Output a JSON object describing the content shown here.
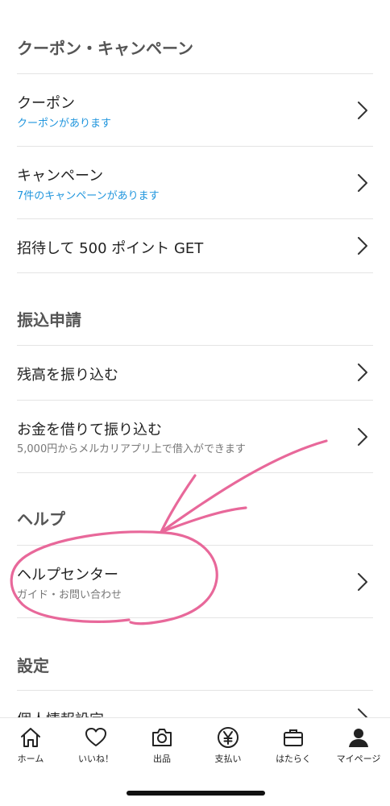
{
  "sections": {
    "coupon": {
      "header": "クーポン・キャンペーン",
      "items": [
        {
          "title": "クーポン",
          "subtitle": "クーポンがあります"
        },
        {
          "title": "キャンペーン",
          "subtitle": "7件のキャンペーンがあります"
        },
        {
          "title": "招待して 500 ポイント GET"
        }
      ]
    },
    "transfer": {
      "header": "振込申請",
      "items": [
        {
          "title": "残高を振り込む"
        },
        {
          "title": "お金を借りて振り込む",
          "subtitle": "5,000円からメルカリアプリ上で借入ができます"
        }
      ]
    },
    "help": {
      "header": "ヘルプ",
      "items": [
        {
          "title": "ヘルプセンター",
          "subtitle": "ガイド・お問い合わせ"
        }
      ]
    },
    "settings": {
      "header": "設定",
      "items": [
        {
          "title": "個人情報設定"
        }
      ]
    }
  },
  "tabbar": {
    "items": [
      {
        "label": "ホーム",
        "icon": "home-icon"
      },
      {
        "label": "いいね！",
        "icon": "heart-icon"
      },
      {
        "label": "出品",
        "icon": "camera-icon"
      },
      {
        "label": "支払い",
        "icon": "yen-icon"
      },
      {
        "label": "はたらく",
        "icon": "briefcase-icon"
      },
      {
        "label": "マイページ",
        "icon": "person-icon"
      }
    ]
  },
  "colors": {
    "accent_link": "#1f95dd",
    "annotation": "#e8689a",
    "text": "#222222",
    "header": "#555555"
  }
}
